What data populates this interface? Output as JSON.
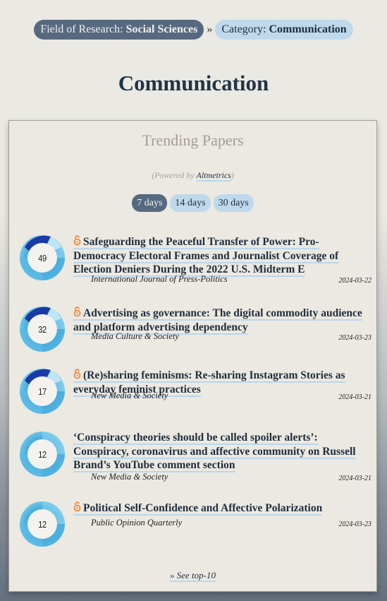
{
  "breadcrumb": {
    "field_label": "Field of Research: ",
    "field_value": "Social Sciences",
    "separator": "»",
    "category_label": "Category: ",
    "category_value": "Communication"
  },
  "page_title": "Communication",
  "trending": {
    "title": "Trending Papers",
    "powered_prefix": "(Powered by ",
    "powered_link": "Altmetrics",
    "powered_suffix": ")",
    "tabs": [
      {
        "label": "7 days",
        "active": true
      },
      {
        "label": "14 days",
        "active": false
      },
      {
        "label": "30 days",
        "active": false
      }
    ],
    "papers": [
      {
        "score": "49",
        "open_access": true,
        "title": "Safeguarding the Peaceful Transfer of Power: Pro-Democracy Electoral Frames and Journalist Coverage of Election Deniers During the 2022 U.S. Midterm E",
        "journal": "International Journal of Press-Politics",
        "date": "2024-03-22"
      },
      {
        "score": "32",
        "open_access": true,
        "title": "Advertising as governance: The digital commodity audience and platform advertising dependency",
        "journal": "Media Culture & Society",
        "date": "2024-03-23"
      },
      {
        "score": "17",
        "open_access": true,
        "title": "(Re)sharing feminisms: Re-sharing Instagram Stories as everyday feminist practices",
        "journal": "New Media & Society",
        "date": "2024-03-21"
      },
      {
        "score": "12",
        "open_access": false,
        "title": "‘Conspiracy theories should be called spoiler alerts’: Conspiracy, coronavirus and affective community on Russell Brand’s YouTube comment section",
        "journal": "New Media & Society",
        "date": "2024-03-21"
      },
      {
        "score": "12",
        "open_access": true,
        "title": "Political Self-Confidence and Affective Polarization",
        "journal": "Public Opinion Quarterly",
        "date": "2024-03-23"
      }
    ],
    "see_top_label": "» See top-10"
  },
  "colors": {
    "active_pill": "#566980",
    "inactive_pill": "#bfd8ec",
    "title_text": "#213447",
    "open_access_orange": "#f0883a",
    "badge_light_blue": "#5bb8e0",
    "badge_dark_blue": "#1a3aa8"
  }
}
